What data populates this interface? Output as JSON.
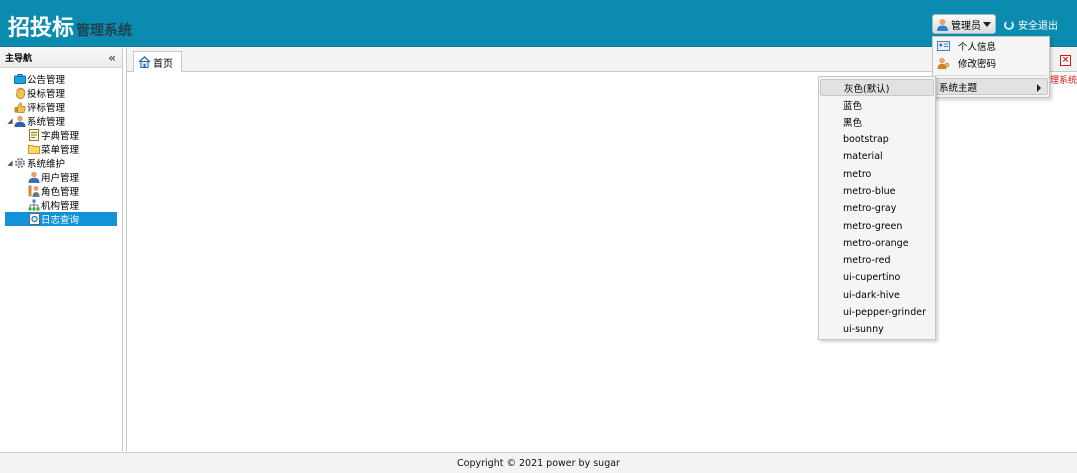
{
  "app": {
    "brand_main": "招投标",
    "brand_sub": "管理系统"
  },
  "header": {
    "user_label": "管理员",
    "logout_label": "安全退出"
  },
  "user_menu": {
    "items": [
      {
        "label": "个人信息",
        "icon": "id-card-icon"
      },
      {
        "label": "修改密码",
        "icon": "user-key-icon"
      }
    ],
    "theme_label": "系统主题"
  },
  "theme_menu": {
    "items": [
      "灰色(默认)",
      "蓝色",
      "黑色",
      "bootstrap",
      "material",
      "metro",
      "metro-blue",
      "metro-gray",
      "metro-green",
      "metro-orange",
      "metro-red",
      "ui-cupertino",
      "ui-dark-hive",
      "ui-pepper-grinder",
      "ui-sunny"
    ],
    "hovered_index": 0
  },
  "sidebar": {
    "title": "主导航",
    "items": [
      {
        "label": "公告管理",
        "icon": "briefcase-icon",
        "level": 0
      },
      {
        "label": "投标管理",
        "icon": "hand-icon",
        "level": 0
      },
      {
        "label": "评标管理",
        "icon": "thumbs-up-icon",
        "level": 0
      },
      {
        "label": "系统管理",
        "icon": "user-icon",
        "level": 0,
        "expanded": true
      },
      {
        "label": "字典管理",
        "icon": "document-icon",
        "level": 1
      },
      {
        "label": "菜单管理",
        "icon": "folder-icon",
        "level": 1
      },
      {
        "label": "系统维护",
        "icon": "gear-icon",
        "level": 0,
        "expanded": true
      },
      {
        "label": "用户管理",
        "icon": "user-icon",
        "level": 1
      },
      {
        "label": "角色管理",
        "icon": "role-icon",
        "level": 1
      },
      {
        "label": "机构管理",
        "icon": "org-icon",
        "level": 1
      },
      {
        "label": "日志查询",
        "icon": "log-icon",
        "level": 1,
        "selected": true
      }
    ]
  },
  "tabs": [
    {
      "label": "首页",
      "icon": "home-icon"
    }
  ],
  "main": {
    "red_text": "管理系统"
  },
  "footer": {
    "copyright": "Copyright © 2021 power by sugar"
  },
  "colors": {
    "header_bg": "#0c8bb0",
    "selected_bg": "#1292d9",
    "close_red": "#dd1111"
  }
}
